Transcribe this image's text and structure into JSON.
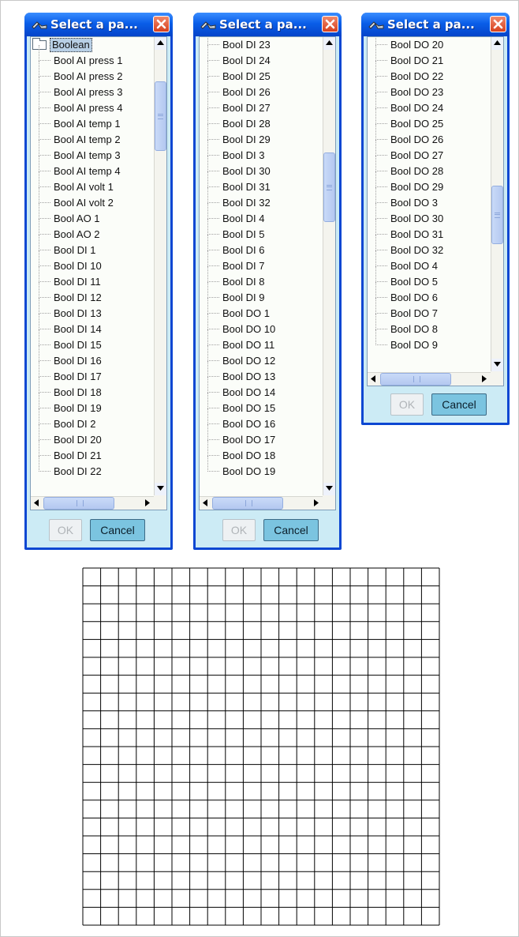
{
  "dialogs": [
    {
      "title": "Select a pa...",
      "root_label": "Boolean",
      "items": [
        "Bool AI press 1",
        "Bool AI press 2",
        "Bool AI press 3",
        "Bool AI press 4",
        "Bool AI temp 1",
        "Bool AI temp 2",
        "Bool AI temp 3",
        "Bool AI temp 4",
        "Bool AI volt 1",
        "Bool AI volt 2",
        "Bool AO 1",
        "Bool AO 2",
        "Bool DI 1",
        "Bool DI 10",
        "Bool DI 11",
        "Bool DI 12",
        "Bool DI 13",
        "Bool DI 14",
        "Bool DI 15",
        "Bool DI 16",
        "Bool DI 17",
        "Bool DI 18",
        "Bool DI 19",
        "Bool DI 2",
        "Bool DI 20",
        "Bool DI 21",
        "Bool DI 22"
      ],
      "ok_label": "OK",
      "cancel_label": "Cancel",
      "scroll_position": 0.05
    },
    {
      "title": "Select a pa...",
      "items": [
        "Bool DI 23",
        "Bool DI 24",
        "Bool DI 25",
        "Bool DI 26",
        "Bool DI 27",
        "Bool DI 28",
        "Bool DI 29",
        "Bool DI 3",
        "Bool DI 30",
        "Bool DI 31",
        "Bool DI 32",
        "Bool DI 4",
        "Bool DI 5",
        "Bool DI 6",
        "Bool DI 7",
        "Bool DI 8",
        "Bool DI 9",
        "Bool DO 1",
        "Bool DO 10",
        "Bool DO 11",
        "Bool DO 12",
        "Bool DO 13",
        "Bool DO 14",
        "Bool DO 15",
        "Bool DO 16",
        "Bool DO 17",
        "Bool DO 18",
        "Bool DO 19"
      ],
      "ok_label": "OK",
      "cancel_label": "Cancel",
      "scroll_position": 0.35
    },
    {
      "title": "Select a pa...",
      "items": [
        "Bool DO 20",
        "Bool DO 21",
        "Bool DO 22",
        "Bool DO 23",
        "Bool DO 24",
        "Bool DO 25",
        "Bool DO 26",
        "Bool DO 27",
        "Bool DO 28",
        "Bool DO 29",
        "Bool DO 3",
        "Bool DO 30",
        "Bool DO 31",
        "Bool DO 32",
        "Bool DO 4",
        "Bool DO 5",
        "Bool DO 6",
        "Bool DO 7",
        "Bool DO 8",
        "Bool DO 9"
      ],
      "ok_label": "OK",
      "cancel_label": "Cancel",
      "scroll_position": 0.85
    }
  ],
  "icons": {
    "title_icon": "tool-icon",
    "close_icon": "close-icon",
    "folder_icon": "folder-icon"
  },
  "colors": {
    "titlebar": "#0a5ee8",
    "dialog_body": "#ccebf5",
    "close_button": "#d7401d",
    "cancel_button": "#7bc4e0",
    "selection": "#b8cfe5"
  },
  "grid": {
    "columns": 20,
    "rows": 20
  }
}
